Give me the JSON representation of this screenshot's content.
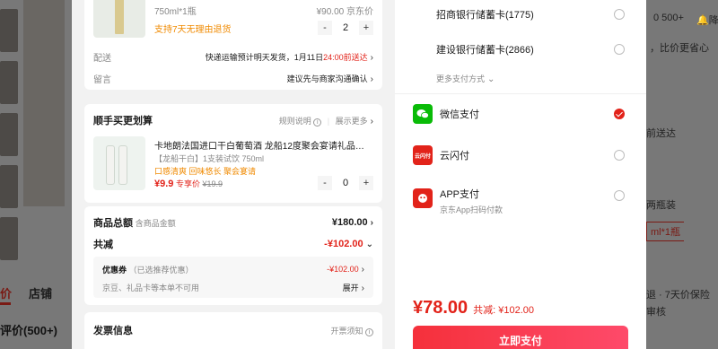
{
  "background": {
    "tabs": [
      "价",
      "店铺"
    ],
    "review_heading": "评价(500+)",
    "right": {
      "badge_count": "0 500+",
      "nav_label": "降价",
      "compare": "，比价更省心",
      "delivery": "前送达",
      "spec": "两瓶装",
      "spec_selected": "ml*1瓶",
      "service1": "退 · 7天价保险",
      "service2": "审核"
    }
  },
  "order": {
    "product": {
      "spec": "750ml*1瓶",
      "price": "¥90.00 京东价",
      "return_policy": "支持7天无理由退货",
      "quantity": "2"
    },
    "delivery": {
      "label": "配送",
      "value_prefix": "快递运输预计明天发货，1月11日",
      "value_highlight": "24:00前送达"
    },
    "message": {
      "label": "留言",
      "value": "建议先与商家沟通确认"
    }
  },
  "addon": {
    "title": "顺手买更划算",
    "rules": "规则说明",
    "more": "展示更多",
    "item": {
      "name": "卡地朗法国进口干白葡萄酒 龙船12度聚会宴请礼品…",
      "spec": "【龙船干白】1支装试饮 750ml",
      "tags": "口感清爽 回味悠长 聚会宴请",
      "price": "¥9.9",
      "price_tag": "专享价",
      "original_price": "¥19.9",
      "quantity": "0"
    }
  },
  "summary": {
    "total_label": "商品总额",
    "total_sub": "含商品金额",
    "total_value": "¥180.00",
    "discount_label": "共减",
    "discount_value": "-¥102.00",
    "coupon_label": "优惠券",
    "coupon_sub": "（已选推荐优惠）",
    "coupon_value": "-¥102.00",
    "coupon_note": "京豆、礼品卡等本单不可用",
    "expand": "展开"
  },
  "invoice": {
    "title": "发票信息",
    "notice": "开票须知"
  },
  "payment": {
    "bank_options": [
      {
        "label": "招商银行储蓄卡(1775)"
      },
      {
        "label": "建设银行储蓄卡(2866)"
      }
    ],
    "more_methods": "更多支付方式",
    "methods": [
      {
        "label": "微信支付",
        "sub": "",
        "icon": "wechat-icon",
        "color": "#09bb07",
        "selected": true
      },
      {
        "label": "云闪付",
        "sub": "",
        "icon": "unionpay-icon",
        "color": "#e2231a",
        "selected": false
      },
      {
        "label": "APP支付",
        "sub": "京东App扫码付款",
        "icon": "jd-app-icon",
        "color": "#e2231a",
        "selected": false
      }
    ],
    "total": "¥78.00",
    "total_discount": "共减: ¥102.00",
    "pay_button": "立即支付"
  }
}
